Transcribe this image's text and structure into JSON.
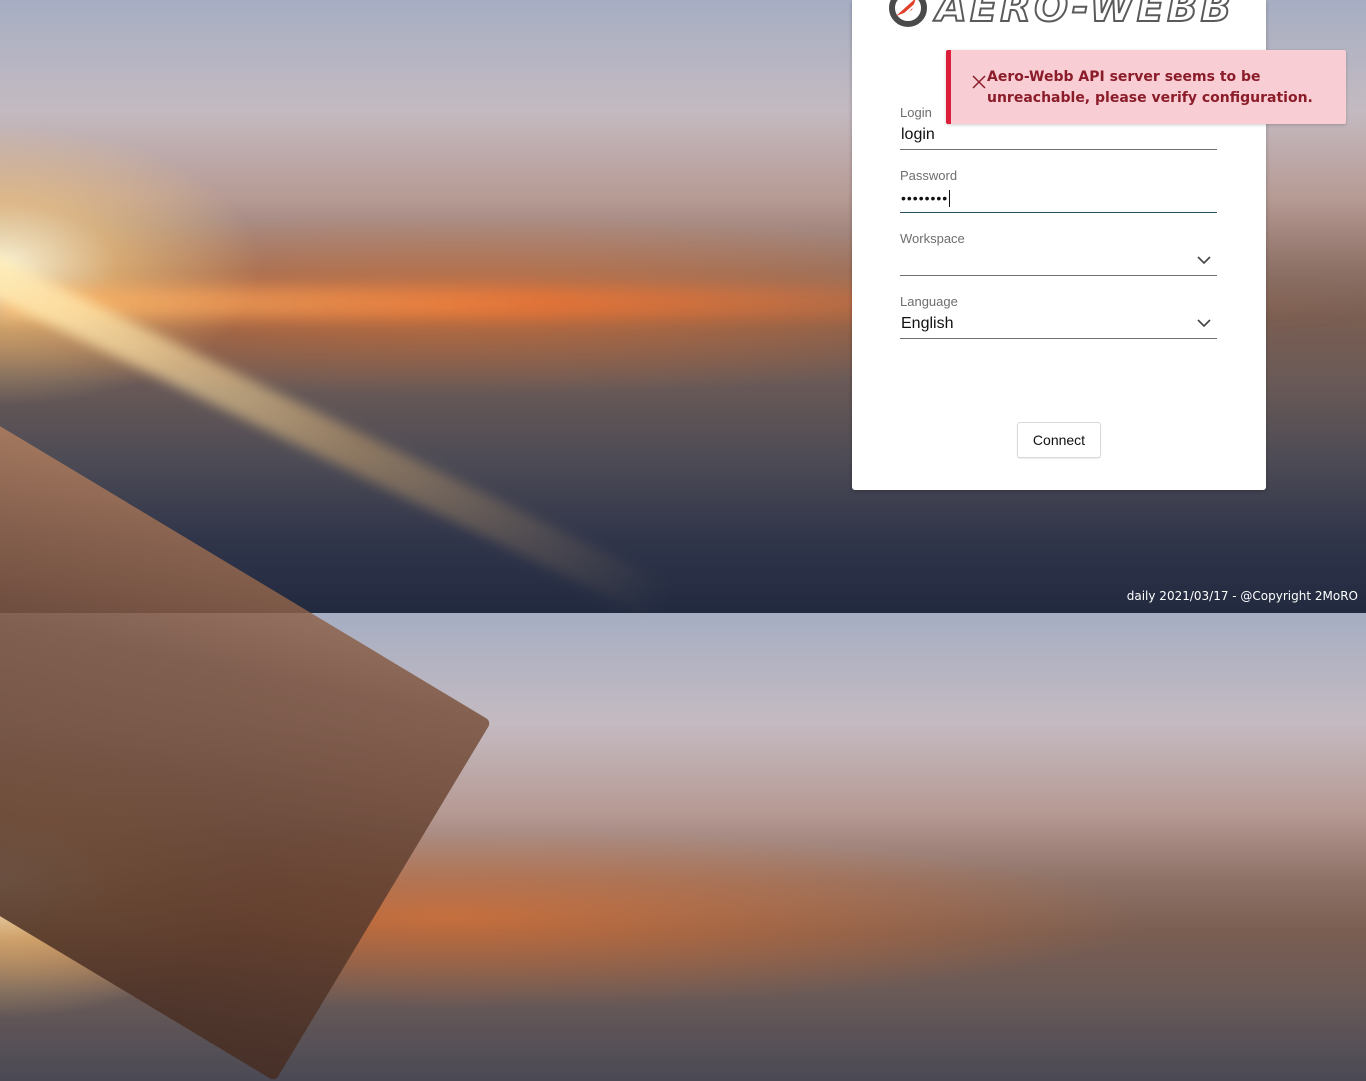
{
  "app": {
    "logo_text": "AERO-WEBB"
  },
  "form": {
    "login": {
      "label": "Login",
      "value": "login"
    },
    "password": {
      "label": "Password",
      "masked_value": "••••••••"
    },
    "workspace": {
      "label": "Workspace",
      "value": ""
    },
    "language": {
      "label": "Language",
      "value": "English"
    },
    "connect_label": "Connect"
  },
  "toast": {
    "type": "error",
    "message": "Aero-Webb API server seems to be unreachable, please verify configuration.",
    "accent_color": "#dc1e3a",
    "background_color": "#f8cdd3"
  },
  "footer": {
    "text": "daily 2021/03/17 - @Copyright 2MoRO"
  },
  "icons": {
    "logo": "aero-webb-logo-icon",
    "toast_close": "close-icon",
    "dropdown": "chevron-down-icon"
  }
}
